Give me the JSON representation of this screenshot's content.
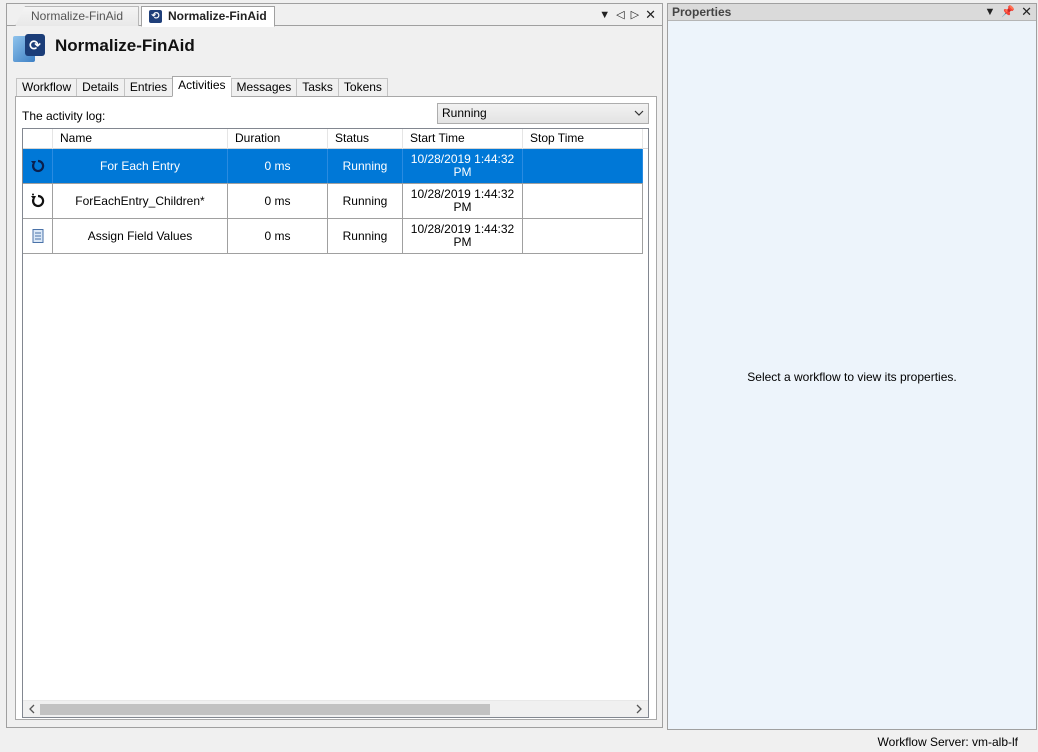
{
  "document_tabs": [
    {
      "label": "Normalize-FinAid",
      "active": false
    },
    {
      "label": "Normalize-FinAid",
      "active": true
    }
  ],
  "workflow": {
    "title": "Normalize-FinAid"
  },
  "inner_tabs": [
    "Workflow",
    "Details",
    "Entries",
    "Activities",
    "Messages",
    "Tasks",
    "Tokens"
  ],
  "selected_inner_tab": "Activities",
  "activity_log": {
    "label": "The activity log:",
    "filter_value": "Running",
    "columns": [
      "Name",
      "Duration",
      "Status",
      "Start Time",
      "Stop Time"
    ],
    "rows": [
      {
        "icon": "loop-icon",
        "name": "For Each Entry",
        "duration": "0 ms",
        "status": "Running",
        "start": "10/28/2019 1:44:32 PM",
        "stop": "",
        "selected": true
      },
      {
        "icon": "loop-children-icon",
        "name": "ForEachEntry_Children*",
        "duration": "0 ms",
        "status": "Running",
        "start": "10/28/2019 1:44:32 PM",
        "stop": "",
        "selected": false
      },
      {
        "icon": "document-icon",
        "name": "Assign Field Values",
        "duration": "0 ms",
        "status": "Running",
        "start": "10/28/2019 1:44:32 PM",
        "stop": "",
        "selected": false
      }
    ]
  },
  "properties": {
    "title": "Properties",
    "empty_message": "Select a workflow to view its properties."
  },
  "status_bar": {
    "text": "Workflow Server: vm-alb-lf"
  },
  "colors": {
    "selection": "#0078d7",
    "panel_bg": "#edf4fb"
  }
}
